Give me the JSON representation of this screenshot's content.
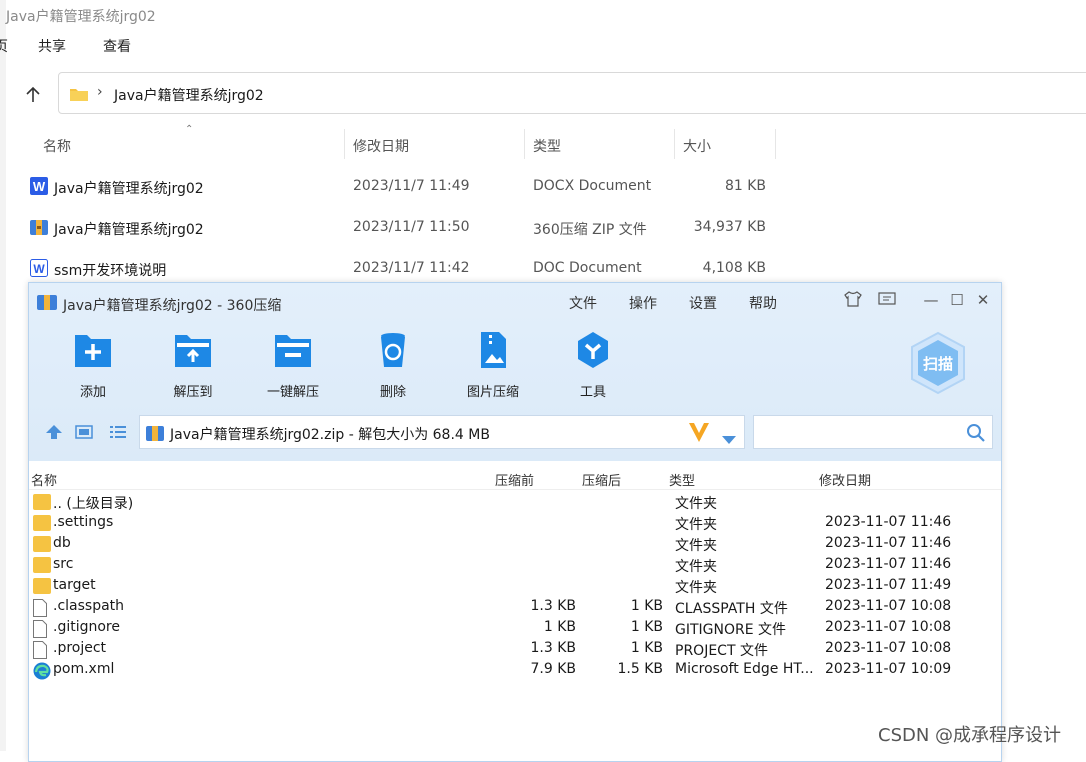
{
  "explorer": {
    "title": "Java户籍管理系统jrg02",
    "menu": [
      "页",
      "共享",
      "查看"
    ],
    "address": "Java户籍管理系统jrg02",
    "columns": {
      "name": "名称",
      "date": "修改日期",
      "type": "类型",
      "size": "大小"
    },
    "files": [
      {
        "name": "Java户籍管理系统jrg02",
        "date": "2023/11/7 11:49",
        "type": "DOCX Document",
        "size": "81 KB",
        "icon": "word-icon"
      },
      {
        "name": "Java户籍管理系统jrg02",
        "date": "2023/11/7 11:50",
        "type": "360压缩 ZIP 文件",
        "size": "34,937 KB",
        "icon": "zip-icon"
      },
      {
        "name": "ssm开发环境说明",
        "date": "2023/11/7 11:42",
        "type": "DOC Document",
        "size": "4,108 KB",
        "icon": "word-icon"
      }
    ]
  },
  "zip_window": {
    "title": "Java户籍管理系统jrg02 - 360压缩",
    "menu": [
      "文件",
      "操作",
      "设置",
      "帮助"
    ],
    "toolbar": [
      "添加",
      "解压到",
      "一键解压",
      "删除",
      "图片压缩",
      "工具"
    ],
    "scan_label": "扫描",
    "path": "Java户籍管理系统jrg02.zip - 解包大小为 68.4 MB",
    "columns": {
      "name": "名称",
      "before": "压缩前",
      "after": "压缩后",
      "type": "类型",
      "date": "修改日期"
    },
    "entries": [
      {
        "name": ".. (上级目录)",
        "before": "",
        "after": "",
        "type": "文件夹",
        "date": "",
        "icon": "folder-icon"
      },
      {
        "name": ".settings",
        "before": "",
        "after": "",
        "type": "文件夹",
        "date": "2023-11-07 11:46",
        "icon": "folder-icon"
      },
      {
        "name": "db",
        "before": "",
        "after": "",
        "type": "文件夹",
        "date": "2023-11-07 11:46",
        "icon": "folder-icon"
      },
      {
        "name": "src",
        "before": "",
        "after": "",
        "type": "文件夹",
        "date": "2023-11-07 11:46",
        "icon": "folder-icon"
      },
      {
        "name": "target",
        "before": "",
        "after": "",
        "type": "文件夹",
        "date": "2023-11-07 11:49",
        "icon": "folder-icon"
      },
      {
        "name": ".classpath",
        "before": "1.3 KB",
        "after": "1 KB",
        "type": "CLASSPATH 文件",
        "date": "2023-11-07 10:08",
        "icon": "file-icon"
      },
      {
        "name": ".gitignore",
        "before": "1 KB",
        "after": "1 KB",
        "type": "GITIGNORE 文件",
        "date": "2023-11-07 10:08",
        "icon": "file-icon"
      },
      {
        "name": ".project",
        "before": "1.3 KB",
        "after": "1 KB",
        "type": "PROJECT 文件",
        "date": "2023-11-07 10:08",
        "icon": "file-icon"
      },
      {
        "name": "pom.xml",
        "before": "7.9 KB",
        "after": "1.5 KB",
        "type": "Microsoft Edge HT...",
        "date": "2023-11-07 10:09",
        "icon": "edge-icon"
      }
    ]
  },
  "watermark": "CSDN @成承程序设计",
  "colors": {
    "accent": "#1e88e5",
    "window_top": "#e3effb",
    "folder": "#f5c342"
  }
}
